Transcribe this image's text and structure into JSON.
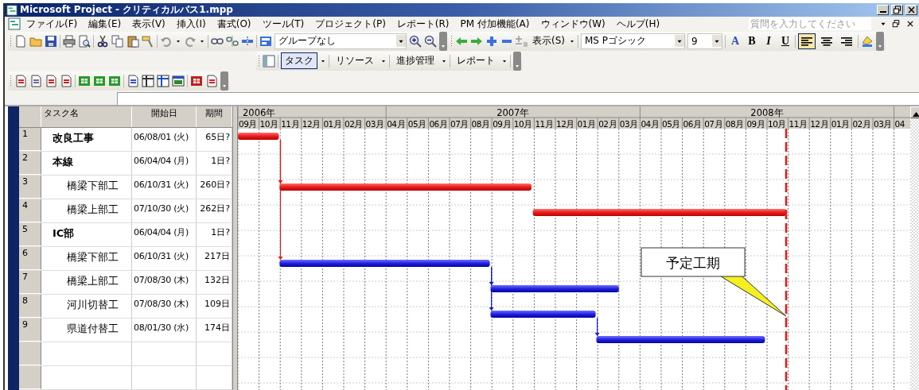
{
  "window": {
    "title": "Microsoft Project - クリティカルパス1.mpp"
  },
  "menu": [
    "ファイル(F)",
    "編集(E)",
    "表示(V)",
    "挿入(I)",
    "書式(O)",
    "ツール(T)",
    "プロジェクト(P)",
    "レポート(R)",
    "PM 付加機能(A)",
    "ウィンドウ(W)",
    "ヘルプ(H)"
  ],
  "help_search": {
    "placeholder": "質問を入力してください"
  },
  "toolbar": {
    "group_select": "グループなし",
    "view_menu": "表示(S)",
    "font": "MS Pゴシック",
    "font_size": "9",
    "format_buttons": [
      {
        "label": "A",
        "kind": "color"
      },
      {
        "label": "B",
        "kind": "bold"
      },
      {
        "label": "I",
        "kind": "italic"
      },
      {
        "label": "U",
        "kind": "underline"
      }
    ],
    "alignments": [
      {
        "kind": "left",
        "selected": true
      },
      {
        "kind": "center",
        "selected": false
      },
      {
        "kind": "right",
        "selected": false
      }
    ]
  },
  "guide_toolbar": [
    {
      "label": "タスク",
      "selected": true
    },
    {
      "label": "リソース",
      "selected": false
    },
    {
      "label": "進捗管理",
      "selected": false
    },
    {
      "label": "レポート",
      "selected": false
    }
  ],
  "table": {
    "columns": [
      "タスク名",
      "開始日",
      "期間"
    ],
    "tasks": [
      {
        "id": "1",
        "name": "改良工事",
        "start": "06/08/01 (火)",
        "duration": "65日?",
        "critical": true
      },
      {
        "id": "2",
        "name": "本線",
        "start": "06/04/04 (月)",
        "duration": "1日?",
        "children": [
          {
            "id": "3",
            "name": "橋梁下部工",
            "start": "06/10/31 (火)",
            "duration": "260日?",
            "critical": true
          },
          {
            "id": "4",
            "name": "橋梁上部工",
            "start": "07/10/30 (火)",
            "duration": "262日?",
            "critical": true
          }
        ]
      },
      {
        "id": "5",
        "name": "IC部",
        "start": "06/04/04 (月)",
        "duration": "1日?",
        "children": [
          {
            "id": "6",
            "name": "橋梁下部工",
            "start": "06/10/31 (火)",
            "duration": "217日",
            "critical": false
          },
          {
            "id": "7",
            "name": "橋梁上部工",
            "start": "07/08/30 (木)",
            "duration": "132日",
            "critical": false
          },
          {
            "id": "8",
            "name": "河川切替工",
            "start": "07/08/30 (木)",
            "duration": "109日",
            "critical": false
          },
          {
            "id": "9",
            "name": "県道付替工",
            "start": "08/01/30 (水)",
            "duration": "174日",
            "critical": false
          }
        ]
      }
    ]
  },
  "timeline": {
    "years": [
      {
        "label": "2006年",
        "months": [
          "09月",
          "10月",
          "11月",
          "12月",
          "01月",
          "02月",
          "03月"
        ]
      },
      {
        "label": "2007年",
        "months": [
          "04月",
          "05月",
          "06月",
          "07月",
          "08月",
          "09月",
          "10月",
          "11月",
          "12月",
          "01月",
          "02月",
          "03月"
        ]
      },
      {
        "label": "2008年",
        "months": [
          "04月",
          "05月",
          "06月",
          "07月",
          "08月",
          "09月",
          "10月",
          "11月",
          "12月",
          "01月",
          "02月",
          "03月"
        ]
      },
      {
        "months": [
          "04"
        ]
      }
    ]
  },
  "callout": {
    "text": "予定工期"
  }
}
